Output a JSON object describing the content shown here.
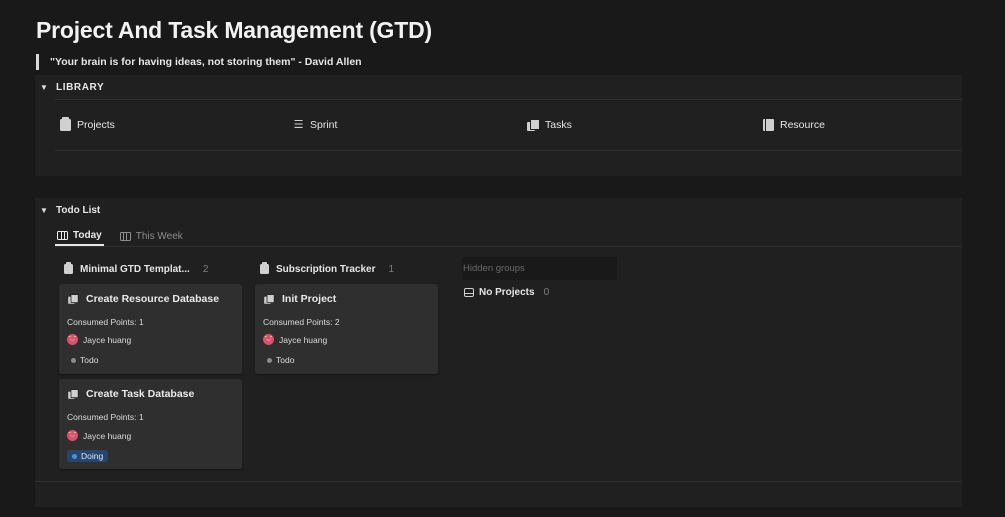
{
  "page": {
    "title": "Project And Task Management (GTD)",
    "quote": "\"Your brain is for having ideas, not storing them\" - David Allen"
  },
  "library": {
    "toggle_label": "LIBRARY",
    "items": [
      {
        "label": "Projects",
        "icon": "page-icon"
      },
      {
        "label": "Sprint",
        "icon": "list-icon"
      },
      {
        "label": "Tasks",
        "icon": "stack-icon"
      },
      {
        "label": "Resource",
        "icon": "book-icon"
      }
    ]
  },
  "todo": {
    "toggle_label": "Todo List",
    "tabs": [
      {
        "label": "Today",
        "active": true
      },
      {
        "label": "This Week",
        "active": false
      }
    ],
    "groups": [
      {
        "name": "Minimal GTD Templat...",
        "count": "2",
        "cards": [
          {
            "title": "Create Resource Database",
            "points": "Consumed Points: 1",
            "assignee": "Jayce huang",
            "avatar": "˘◡˘",
            "status": "Todo"
          },
          {
            "title": "Create Task Database",
            "points": "Consumed Points: 1",
            "assignee": "Jayce huang",
            "avatar": "˘◡˘",
            "status": "Doing"
          }
        ]
      },
      {
        "name": "Subscription Tracker",
        "count": "1",
        "cards": [
          {
            "title": "Init Project",
            "points": "Consumed Points: 2",
            "assignee": "Jayce huang",
            "avatar": "˘◡˘",
            "status": "Todo"
          }
        ]
      }
    ],
    "hidden_groups_label": "Hidden groups",
    "no_projects": {
      "label": "No Projects",
      "count": "0"
    }
  },
  "colors": {
    "background": "#191919",
    "panel": "#202020",
    "card": "#2f2f2f",
    "status_todo_dot": "#8c8c8c",
    "status_doing_bg": "#28456c",
    "status_doing_dot": "#4a8fe0",
    "avatar": "#d9536b"
  }
}
